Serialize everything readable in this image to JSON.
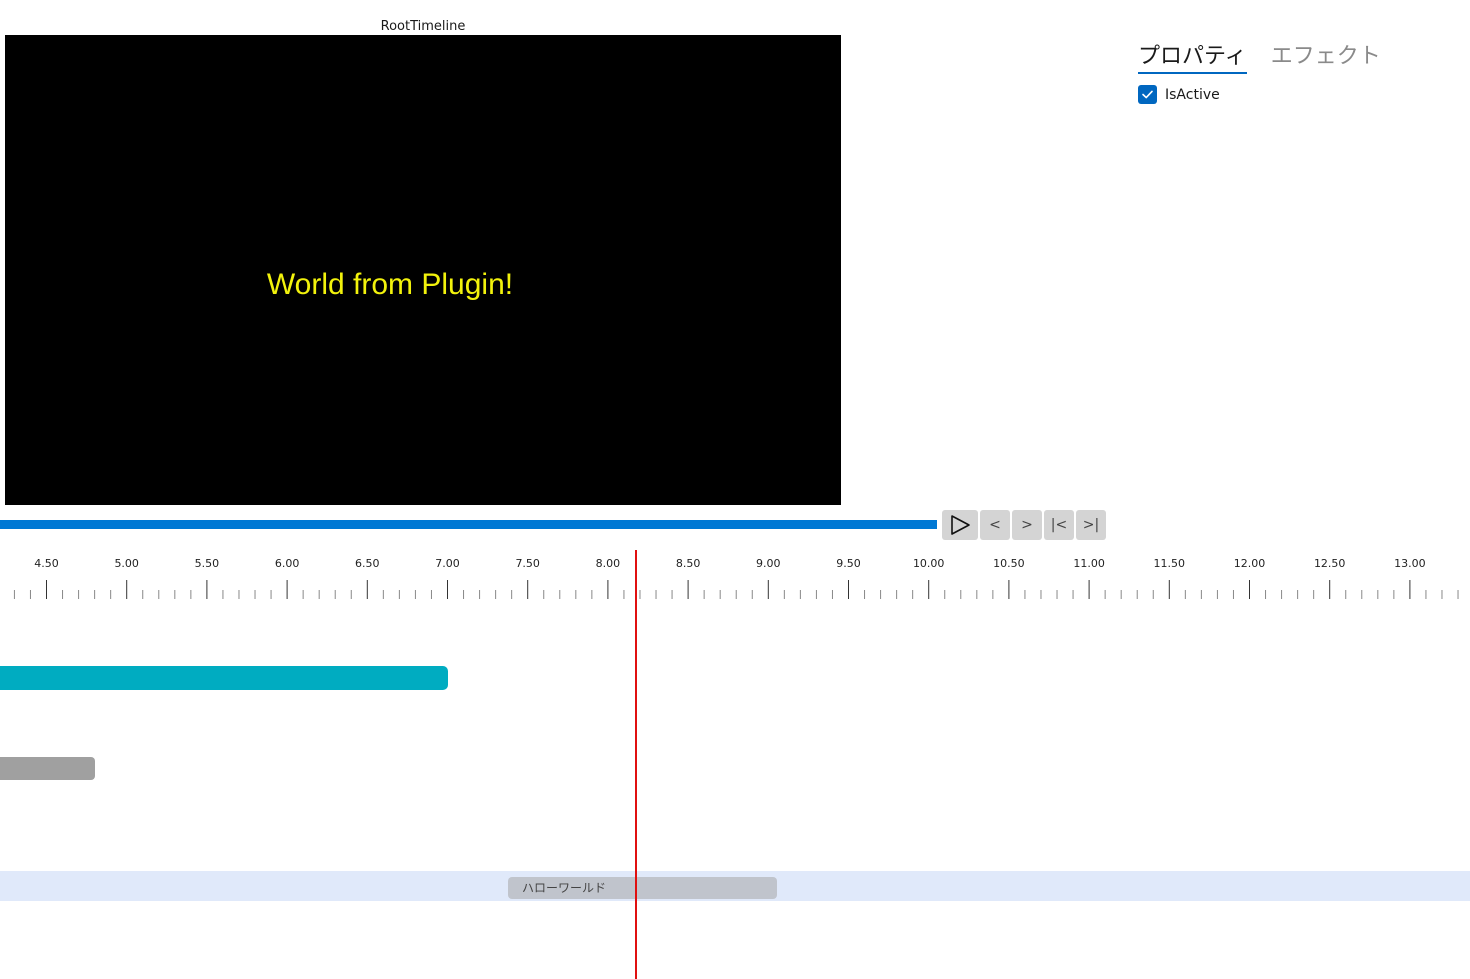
{
  "preview": {
    "title": "RootTimeline",
    "text": "World from Plugin!",
    "text_color": "#f2f20c",
    "background": "#000000"
  },
  "properties": {
    "tabs": [
      {
        "label": "プロパティ",
        "active": true
      },
      {
        "label": "エフェクト",
        "active": false
      }
    ],
    "is_active_label": "IsActive",
    "is_active_checked": true
  },
  "playback": {
    "accent": "#0078d4",
    "buttons": [
      {
        "name": "play",
        "label": "▷"
      },
      {
        "name": "prev-frame",
        "label": "<"
      },
      {
        "name": "next-frame",
        "label": ">"
      },
      {
        "name": "go-start",
        "label": "|<"
      },
      {
        "name": "go-end",
        "label": ">|"
      }
    ]
  },
  "ruler": {
    "labels": [
      "4.50",
      "5.00",
      "5.50",
      "6.00",
      "6.50",
      "7.00",
      "7.50",
      "8.00",
      "8.50",
      "9.00",
      "9.50",
      "10.00",
      "10.50",
      "11.00",
      "11.50",
      "12.00",
      "12.50",
      "13.00"
    ]
  },
  "timeline": {
    "clips": [
      {
        "name": "teal-clip",
        "color": "#00acc1",
        "end_time": 7.0
      },
      {
        "name": "gray-clip",
        "color": "#a0a0a0",
        "end_time": 4.8
      },
      {
        "name": "hello-world-clip",
        "label": "ハローワールド",
        "start_time": 7.5,
        "end_time": 9.05
      }
    ],
    "playhead_time": 8.17,
    "playhead_color": "#e01010"
  }
}
